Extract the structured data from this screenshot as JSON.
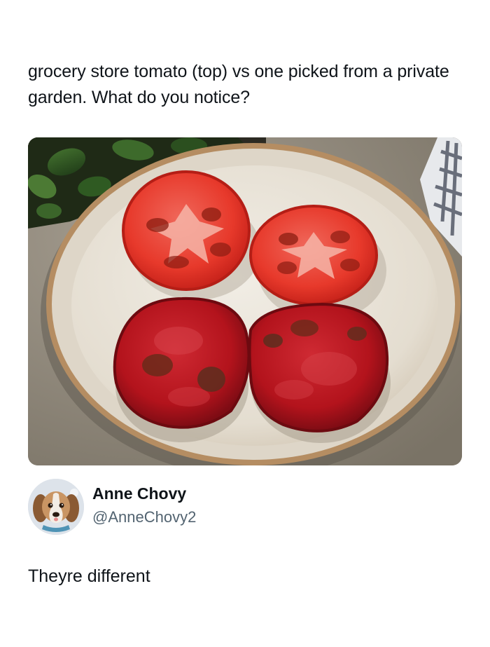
{
  "post": {
    "text": "grocery store tomato (top) vs one picked from a private garden. What do you notice?"
  },
  "author": {
    "name": "Anne Chovy",
    "handle": "@AnneChovy2",
    "avatar_icon": "beagle-puppy-avatar"
  },
  "reply": {
    "text": "Theyre different"
  },
  "photo": {
    "subject": "four tomato halves on a plate",
    "colors": {
      "store_tomato": "#e7392b",
      "garden_tomato": "#b3131c",
      "plate": "#e9e4d9",
      "rim": "#b58d62"
    }
  }
}
